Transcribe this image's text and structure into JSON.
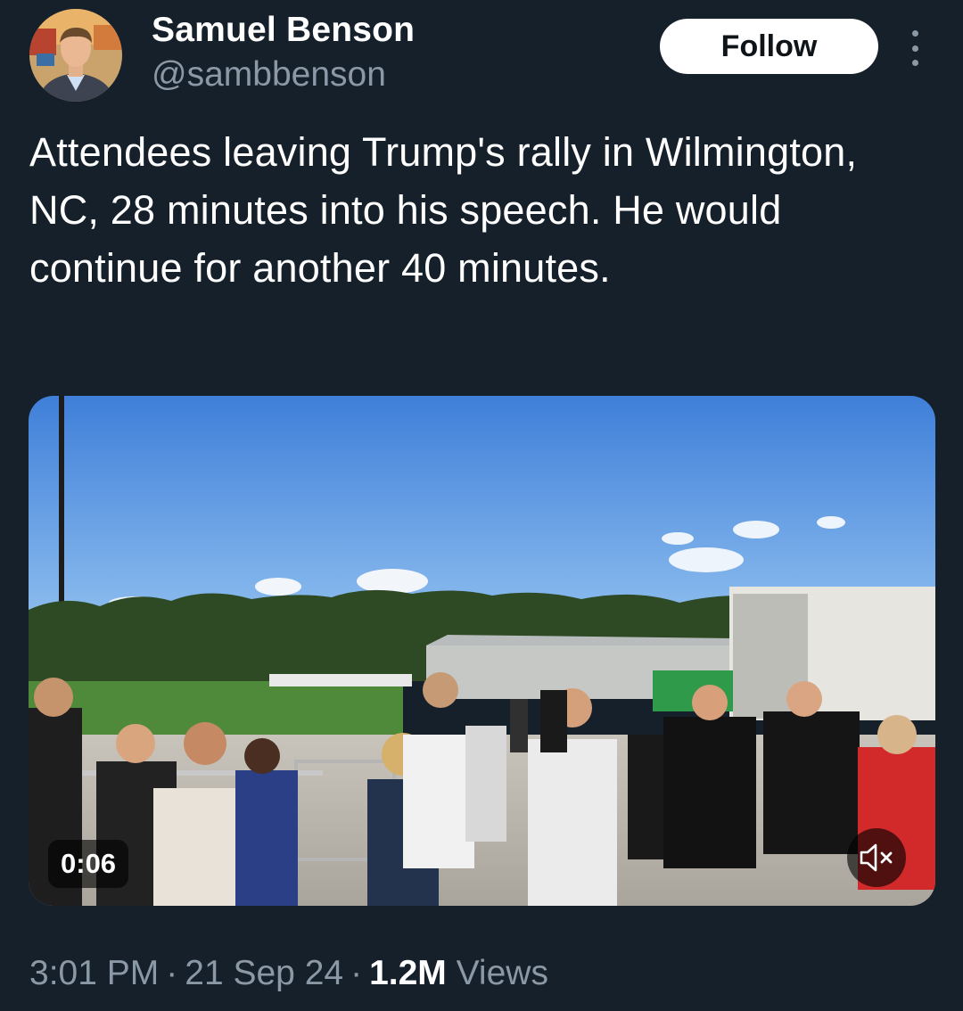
{
  "author": {
    "display_name": "Samuel Benson",
    "handle": "@sambbenson"
  },
  "actions": {
    "follow_label": "Follow",
    "more_icon": "more-vertical-icon"
  },
  "tweet": {
    "text": "Attendees leaving Trump's rally in Wilmington, NC, 28 minutes into his speech. He would continue for another 40 minutes."
  },
  "media": {
    "type": "video",
    "duration": "0:06",
    "mute_icon": "volume-muted-icon"
  },
  "meta": {
    "time": "3:01 PM",
    "separator": "·",
    "date": "21 Sep 24",
    "views_count": "1.2M",
    "views_label": "Views"
  },
  "colors": {
    "background": "#15202b",
    "secondary_text": "#8b98a5",
    "follow_button_bg": "#ffffff"
  }
}
